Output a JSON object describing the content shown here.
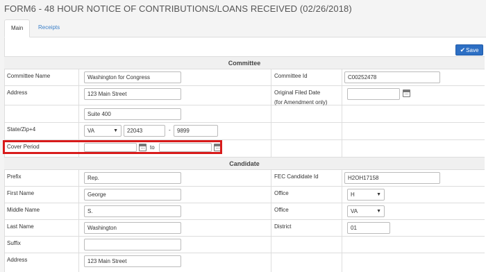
{
  "title": "FORM6 - 48 HOUR NOTICE OF CONTRIBUTIONS/LOANS RECEIVED (02/26/2018)",
  "tabs": [
    {
      "label": "Main",
      "active": true
    },
    {
      "label": "Receipts",
      "active": false
    }
  ],
  "save_label": "Save",
  "committee": {
    "heading": "Committee",
    "name_label": "Committee Name",
    "name_value": "Washington for Congress",
    "id_label": "Committee Id",
    "id_value": "C00252478",
    "address_label": "Address",
    "address1_value": "123 Main Street",
    "address2_value": "Suite 400",
    "original_filed_label": "Original Filed Date",
    "original_filed_sub": "(for Amendment only)",
    "original_filed_value": "",
    "state_zip_label": "State/Zip+4",
    "state_value": "VA",
    "zip_value": "22043",
    "zip4_value": "9899",
    "zip_sep": "-",
    "cover_period_label": "Cover Period",
    "cover_from_value": "",
    "cover_to_label": "to",
    "cover_to_value": ""
  },
  "candidate": {
    "heading": "Candidate",
    "prefix_label": "Prefix",
    "prefix_value": "Rep.",
    "fec_id_label": "FEC Candidate Id",
    "fec_id_value": "H2OH17158",
    "first_name_label": "First Name",
    "first_name_value": "George",
    "office_label": "Office",
    "office_value": "H",
    "middle_name_label": "Middle Name",
    "middle_name_value": "S.",
    "office_state_label": "Office",
    "office_state_value": "VA",
    "last_name_label": "Last Name",
    "last_name_value": "Washington",
    "district_label": "District",
    "district_value": "01",
    "suffix_label": "Suffix",
    "suffix_value": "",
    "address_label": "Address",
    "address_value": "123 Main Street"
  },
  "accent_color": "#2d6fc4",
  "highlight_color": "#d81b1b",
  "icons": [
    "calendar-icon",
    "checkmark-icon",
    "dropdown-arrow-icon"
  ]
}
